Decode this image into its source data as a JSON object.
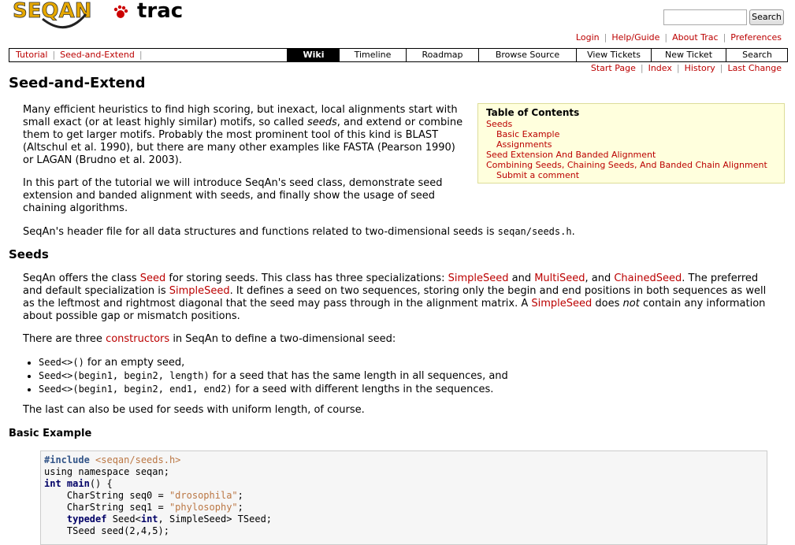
{
  "header": {
    "logo_text_seqan": "SEQAN",
    "logo_text_trac": "trac",
    "search_placeholder": "",
    "search_button": "Search"
  },
  "metanav": [
    "Login",
    "Help/Guide",
    "About Trac",
    "Preferences"
  ],
  "context_nav": [
    "Tutorial",
    "Seed-and-Extend"
  ],
  "main_nav": {
    "tabs": [
      "Wiki",
      "Timeline",
      "Roadmap",
      "Browse Source",
      "View Tickets",
      "New Ticket",
      "Search"
    ],
    "active": "Wiki"
  },
  "subnav": [
    "Start Page",
    "Index",
    "History",
    "Last Change"
  ],
  "page": {
    "title": "Seed-and-Extend",
    "intro1_a": "Many efficient heuristics to find high scoring, but inexact, local alignments start with small exact (or at least highly similar) motifs, so called ",
    "intro1_em": "seeds",
    "intro1_b": ", and extend or combine them to get larger motifs. Probably the most prominent tool of this kind is BLAST (Altschul et al. 1990), but there are many other examples like FASTA (Pearson 1990) or LAGAN (Brudno et al. 2003).",
    "intro2": "In this part of the tutorial we will introduce SeqAn's seed class, demonstrate seed extension and banded alignment with seeds, and finally show the usage of seed chaining algorithms.",
    "intro3_a": "SeqAn's header file for all data structures and functions related to two-dimensional seeds is ",
    "intro3_code": "seqan/seeds.h",
    "intro3_b": ".",
    "seeds_heading": "Seeds",
    "seeds_p1": {
      "t1": "SeqAn offers the class ",
      "l1": "Seed",
      "t2": " for storing seeds. This class has three specializations: ",
      "l2": "SimpleSeed",
      "t3": " and ",
      "l3": "MultiSeed",
      "t4": ", and ",
      "l4": "ChainedSeed",
      "t5": ". The preferred and default specialization is ",
      "l5": "SimpleSeed",
      "t6": ". It defines a seed on two sequences, storing only the begin and end positions in both sequences as well as the leftmost and rightmost diagonal that the seed may pass through in the alignment matrix. A ",
      "l6": "SimpleSeed",
      "t7": " does ",
      "em": "not",
      "t8": " contain any information about possible gap or mismatch positions."
    },
    "seeds_p2_a": "There are three ",
    "seeds_p2_link": "constructors",
    "seeds_p2_b": " in SeqAn to define a two-dimensional seed:",
    "bullets": [
      {
        "code": "Seed<>()",
        "text": " for an empty seed,"
      },
      {
        "code": "Seed<>(begin1, begin2, length)",
        "text": " for a seed that has the same length in all sequences, and"
      },
      {
        "code": "Seed<>(begin1, begin2, end1, end2)",
        "text": " for a seed with different lengths in the sequences."
      }
    ],
    "seeds_p3": "The last can also be used for seeds with uniform length, of course.",
    "basic_heading": "Basic Example"
  },
  "toc": {
    "title": "Table of Contents",
    "items": [
      {
        "label": "Seeds",
        "level": 1
      },
      {
        "label": "Basic Example",
        "level": 2
      },
      {
        "label": "Assignments",
        "level": 2
      },
      {
        "label": "Seed Extension And Banded Alignment",
        "level": 1
      },
      {
        "label": "Combining Seeds, Chaining Seeds, And Banded Chain Alignment",
        "level": 1
      },
      {
        "label": "Submit a comment",
        "level": 2
      }
    ]
  },
  "code": {
    "l1_kw": "#include",
    "l1_str": "<seqan/seeds.h>",
    "l2": "using namespace seqan;",
    "l3_kw": "int",
    "l3_fn": "main",
    "l3_rest": "() {",
    "l4_a": "    CharString seq0 = ",
    "l4_str": "\"drosophila\"",
    "l4_b": ";",
    "l5_a": "    CharString seq1 = ",
    "l5_str": "\"phylosophy\"",
    "l5_b": ";",
    "l6_kw": "typedef",
    "l6_a": " Seed<",
    "l6_kw2": "int",
    "l6_b": ", SimpleSeed> TSeed;",
    "l7": "    TSeed seed(2,4,5);"
  }
}
